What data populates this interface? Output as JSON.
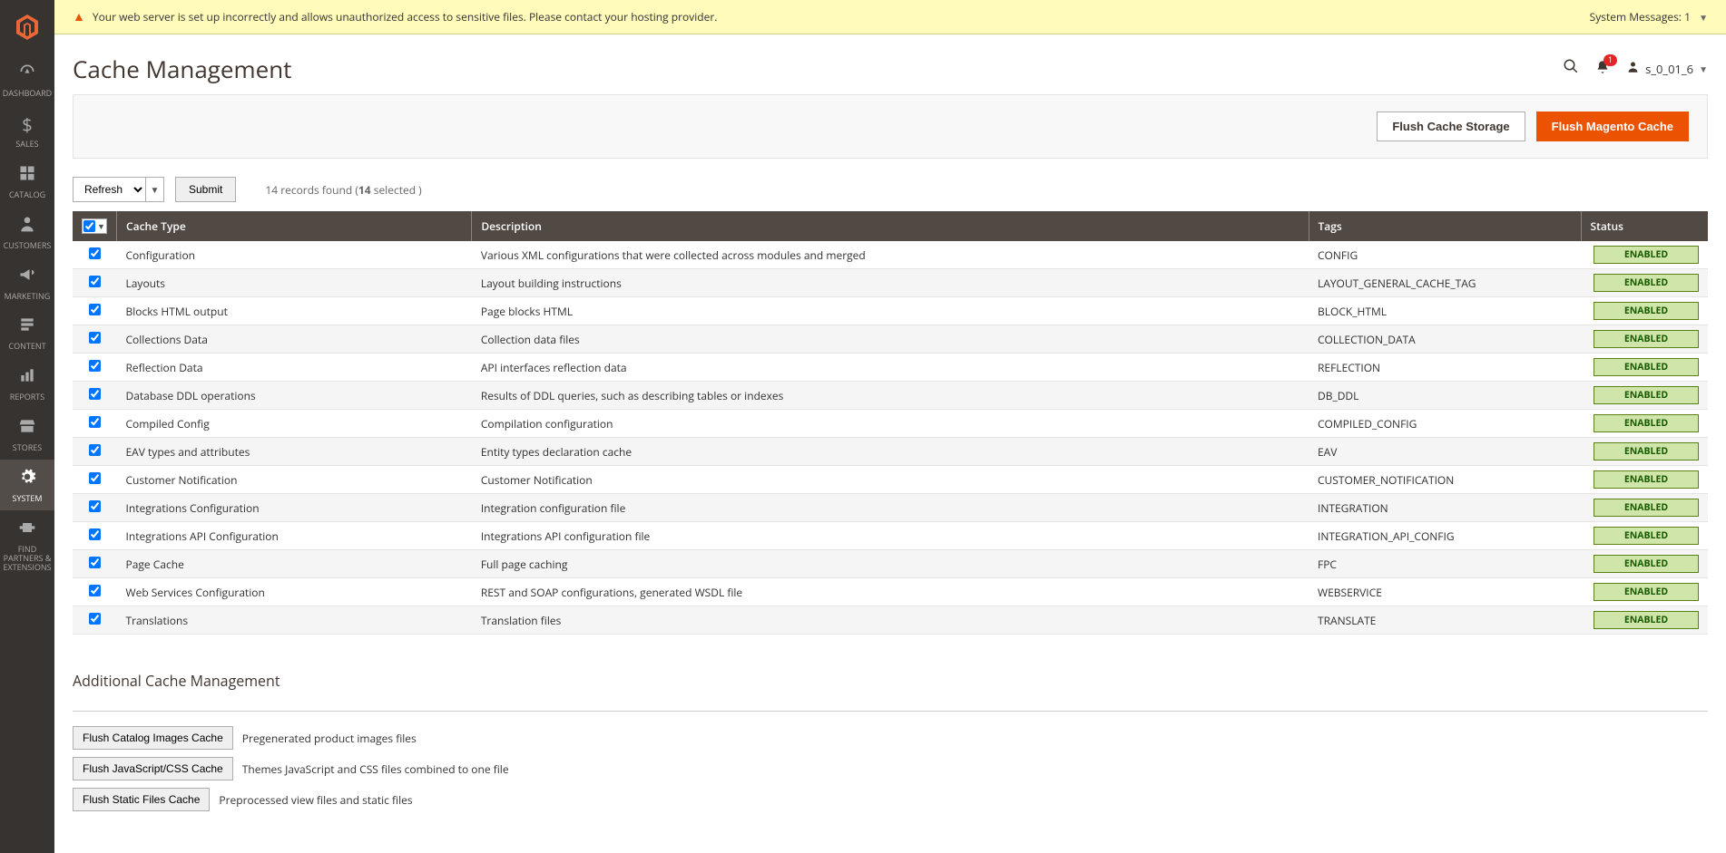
{
  "sidebar": {
    "items": [
      {
        "label": "DASHBOARD",
        "icon": "dashboard"
      },
      {
        "label": "SALES",
        "icon": "dollar"
      },
      {
        "label": "CATALOG",
        "icon": "catalog"
      },
      {
        "label": "CUSTOMERS",
        "icon": "person"
      },
      {
        "label": "MARKETING",
        "icon": "megaphone"
      },
      {
        "label": "CONTENT",
        "icon": "content"
      },
      {
        "label": "REPORTS",
        "icon": "reports"
      },
      {
        "label": "STORES",
        "icon": "stores"
      },
      {
        "label": "SYSTEM",
        "icon": "gear"
      },
      {
        "label": "FIND PARTNERS & EXTENSIONS",
        "icon": "partners"
      }
    ]
  },
  "system_message": {
    "text": "Your web server is set up incorrectly and allows unauthorized access to sensitive files. Please contact your hosting provider.",
    "count_label": "System Messages:",
    "count": "1"
  },
  "page_title": "Cache Management",
  "user_name": "s_0_01_6",
  "notification_count": "1",
  "actions": {
    "flush_storage": "Flush Cache Storage",
    "flush_magento": "Flush Magento Cache"
  },
  "controls": {
    "mass_action": "Refresh",
    "submit": "Submit",
    "records_prefix": "14 records found (",
    "records_bold": "14",
    "records_suffix": " selected )"
  },
  "table": {
    "headers": {
      "cache_type": "Cache Type",
      "description": "Description",
      "tags": "Tags",
      "status": "Status"
    },
    "rows": [
      {
        "type": "Configuration",
        "desc": "Various XML configurations that were collected across modules and merged",
        "tags": "CONFIG",
        "status": "ENABLED"
      },
      {
        "type": "Layouts",
        "desc": "Layout building instructions",
        "tags": "LAYOUT_GENERAL_CACHE_TAG",
        "status": "ENABLED"
      },
      {
        "type": "Blocks HTML output",
        "desc": "Page blocks HTML",
        "tags": "BLOCK_HTML",
        "status": "ENABLED"
      },
      {
        "type": "Collections Data",
        "desc": "Collection data files",
        "tags": "COLLECTION_DATA",
        "status": "ENABLED"
      },
      {
        "type": "Reflection Data",
        "desc": "API interfaces reflection data",
        "tags": "REFLECTION",
        "status": "ENABLED"
      },
      {
        "type": "Database DDL operations",
        "desc": "Results of DDL queries, such as describing tables or indexes",
        "tags": "DB_DDL",
        "status": "ENABLED"
      },
      {
        "type": "Compiled Config",
        "desc": "Compilation configuration",
        "tags": "COMPILED_CONFIG",
        "status": "ENABLED"
      },
      {
        "type": "EAV types and attributes",
        "desc": "Entity types declaration cache",
        "tags": "EAV",
        "status": "ENABLED"
      },
      {
        "type": "Customer Notification",
        "desc": "Customer Notification",
        "tags": "CUSTOMER_NOTIFICATION",
        "status": "ENABLED"
      },
      {
        "type": "Integrations Configuration",
        "desc": "Integration configuration file",
        "tags": "INTEGRATION",
        "status": "ENABLED"
      },
      {
        "type": "Integrations API Configuration",
        "desc": "Integrations API configuration file",
        "tags": "INTEGRATION_API_CONFIG",
        "status": "ENABLED"
      },
      {
        "type": "Page Cache",
        "desc": "Full page caching",
        "tags": "FPC",
        "status": "ENABLED"
      },
      {
        "type": "Web Services Configuration",
        "desc": "REST and SOAP configurations, generated WSDL file",
        "tags": "WEBSERVICE",
        "status": "ENABLED"
      },
      {
        "type": "Translations",
        "desc": "Translation files",
        "tags": "TRANSLATE",
        "status": "ENABLED"
      }
    ]
  },
  "additional": {
    "title": "Additional Cache Management",
    "rows": [
      {
        "btn": "Flush Catalog Images Cache",
        "desc": "Pregenerated product images files"
      },
      {
        "btn": "Flush JavaScript/CSS Cache",
        "desc": "Themes JavaScript and CSS files combined to one file"
      },
      {
        "btn": "Flush Static Files Cache",
        "desc": "Preprocessed view files and static files"
      }
    ]
  }
}
